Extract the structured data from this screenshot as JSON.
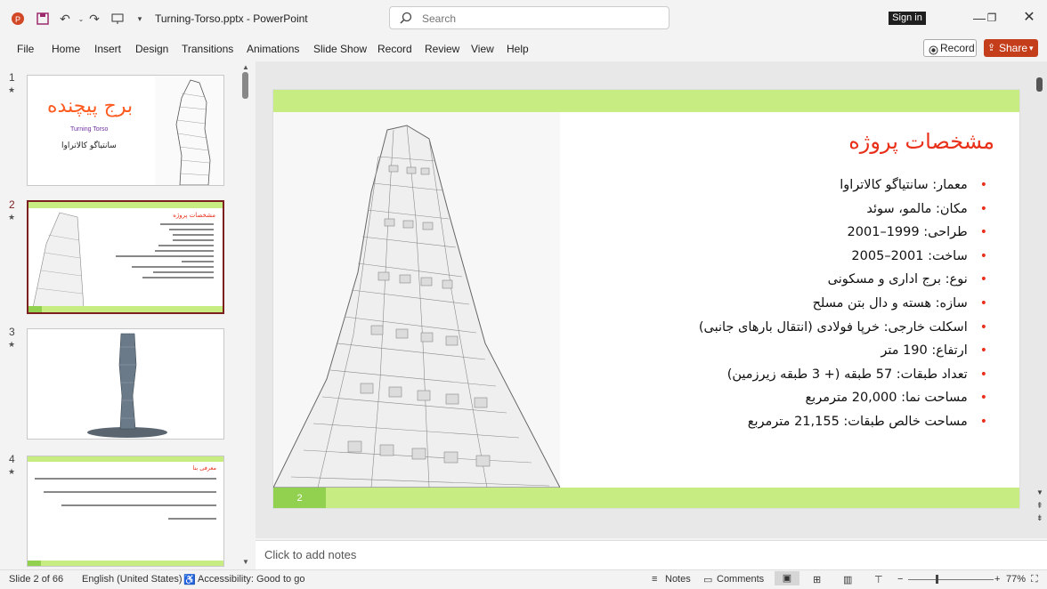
{
  "app": {
    "file_title": "Turning-Torso.pptx  -  PowerPoint",
    "search_placeholder": "Search",
    "sign_in": "Sign in"
  },
  "ribbon": {
    "tabs": [
      "File",
      "Home",
      "Insert",
      "Design",
      "Transitions",
      "Animations",
      "Slide Show",
      "Record",
      "Review",
      "View",
      "Help"
    ],
    "record_label": "Record",
    "share_label": "Share"
  },
  "thumbnails": [
    {
      "num": "1",
      "star": "★",
      "title": "برج پیچنده",
      "subtitle": "Turning Torso",
      "author": "سانتیاگو کالاتراوا"
    },
    {
      "num": "2",
      "star": "★",
      "title": "مشخصات پروژه"
    },
    {
      "num": "3",
      "star": "★"
    },
    {
      "num": "4",
      "star": "★",
      "title": "معرفی بنا"
    }
  ],
  "slide": {
    "title": "مشخصات پروژه",
    "number": "2",
    "bullets": [
      "معمار: سانتیاگو کالاتراوا",
      "مکان: مالمو، سوئد",
      "طراحی: 1999–2001",
      "ساخت: 2001–2005",
      "نوع: برج اداری و مسکونی",
      "سازه: هسته و دال بتن مسلح",
      "اسکلت خارجی: خرپا فولادی (انتقال بارهای جانبی)",
      "ارتفاع: 190 متر",
      "تعداد طبقات: 57 طبقه (+ 3 طبقه زیرزمین)",
      "مساحت نما: 20,000 مترمربع",
      "مساحت خالص طبقات: 21,155 مترمربع"
    ]
  },
  "notes_placeholder": "Click to add notes",
  "status": {
    "slide_info": "Slide 2 of 66",
    "language": "English (United States)",
    "accessibility": "Accessibility: Good to go",
    "notes": "Notes",
    "comments": "Comments",
    "zoom": "77%"
  },
  "colors": {
    "accent_red": "#e8301a",
    "band_green": "#c6ec82",
    "share_orange": "#c43e1c"
  }
}
